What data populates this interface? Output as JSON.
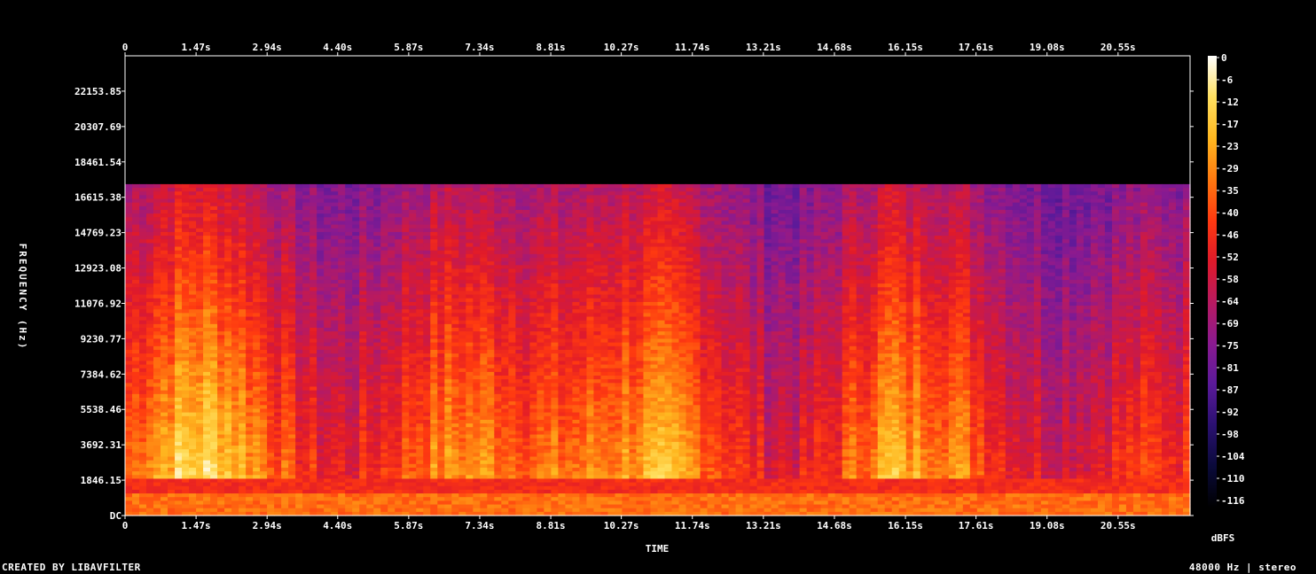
{
  "chart_data": {
    "type": "heatmap",
    "title": "",
    "xlabel": "TIME",
    "ylabel": "FREQUENCY (Hz)",
    "colorbar_label": "dBFS",
    "x_tick_labels": [
      "0",
      "1.47s",
      "2.94s",
      "4.40s",
      "5.87s",
      "7.34s",
      "8.81s",
      "10.27s",
      "11.74s",
      "13.21s",
      "14.68s",
      "16.15s",
      "17.61s",
      "19.08s",
      "20.55s"
    ],
    "x_tick_values": [
      0,
      1.47,
      2.94,
      4.4,
      5.87,
      7.34,
      8.81,
      10.27,
      11.74,
      13.21,
      14.68,
      16.15,
      17.61,
      19.08,
      20.55
    ],
    "xlim": [
      0,
      22.04
    ],
    "y_tick_labels": [
      "DC",
      "1846.15",
      "3692.31",
      "5538.46",
      "7384.62",
      "9230.77",
      "11076.92",
      "12923.08",
      "14769.23",
      "16615.38",
      "18461.54",
      "20307.69",
      "22153.85"
    ],
    "y_tick_values": [
      0,
      1846.15,
      3692.31,
      5538.46,
      7384.62,
      9230.77,
      11076.92,
      12923.08,
      14769.23,
      16615.38,
      18461.54,
      20307.69,
      22153.85
    ],
    "ylim": [
      0,
      24000
    ],
    "colorbar_tick_labels": [
      "0",
      "-6",
      "-12",
      "-17",
      "-23",
      "-29",
      "-35",
      "-40",
      "-46",
      "-52",
      "-58",
      "-64",
      "-69",
      "-75",
      "-81",
      "-87",
      "-92",
      "-98",
      "-104",
      "-110",
      "-116"
    ],
    "colorbar_range": [
      -120,
      0
    ],
    "cutoff_frequency_hz": 17300,
    "colormap": [
      "#000000",
      "#0a0a3a",
      "#2a1070",
      "#5a1a9a",
      "#8a1a90",
      "#b81a60",
      "#e01a2a",
      "#ff3a10",
      "#ff7a10",
      "#ffb820",
      "#ffe060",
      "#ffffff"
    ]
  },
  "footer": {
    "credit": "CREATED BY LIBAVFILTER",
    "info": "48000 Hz | stereo"
  }
}
